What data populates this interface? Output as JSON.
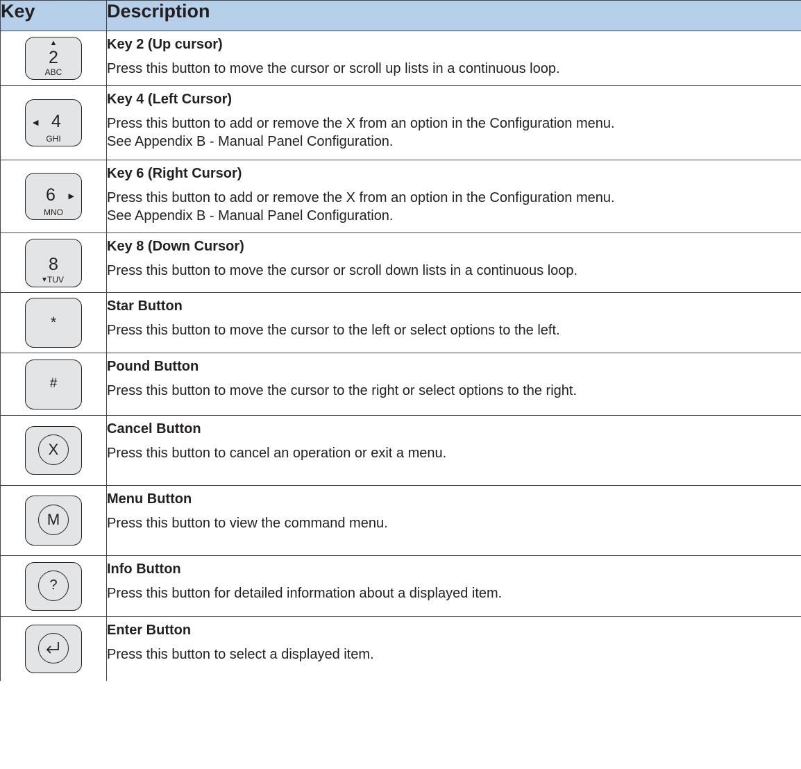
{
  "header": {
    "key": "Key",
    "description": "Description"
  },
  "rows": [
    {
      "icon": "key-2-up-cursor-icon",
      "digit": "2",
      "letters": "ABC",
      "title": "Key 2 (Up cursor)",
      "text": [
        "Press this button to move the cursor or scroll up lists in a continuous loop."
      ]
    },
    {
      "icon": "key-4-left-cursor-icon",
      "digit": "4",
      "letters": "GHI",
      "title": "Key 4 (Left Cursor)",
      "text": [
        "Press this button to add or remove the X from an option in the Configuration menu.",
        "See Appendix B - Manual Panel Configuration."
      ]
    },
    {
      "icon": "key-6-right-cursor-icon",
      "digit": "6",
      "letters": "MNO",
      "title": "Key 6 (Right Cursor)",
      "text": [
        "Press this button to add or remove the X from an option in the Configuration menu.",
        "See Appendix B - Manual Panel Configuration."
      ]
    },
    {
      "icon": "key-8-down-cursor-icon",
      "digit": "8",
      "letters": "TUV",
      "title": "Key 8 (Down Cursor)",
      "text": [
        "Press this button to move the cursor or scroll down lists in a continuous loop."
      ]
    },
    {
      "icon": "star-key-icon",
      "symbol": "*",
      "title": "Star Button",
      "text": [
        "Press this button to move the cursor to the left or select options to the left."
      ]
    },
    {
      "icon": "pound-key-icon",
      "symbol": "#",
      "title": "Pound Button",
      "text": [
        "Press this button to move the cursor to the right or select options to the right."
      ]
    },
    {
      "icon": "cancel-x-icon",
      "symbol": "X",
      "title": "Cancel Button",
      "text": [
        "Press this button to cancel an operation or exit a menu."
      ]
    },
    {
      "icon": "menu-m-icon",
      "symbol": "M",
      "title": "Menu Button",
      "text": [
        "Press this button to view the command menu."
      ]
    },
    {
      "icon": "info-question-icon",
      "symbol": "?",
      "title": "Info Button",
      "text": [
        "Press this button for detailed information about a displayed item."
      ]
    },
    {
      "icon": "enter-return-icon",
      "title": "Enter Button",
      "text": [
        "Press this button to select a displayed item."
      ]
    }
  ]
}
